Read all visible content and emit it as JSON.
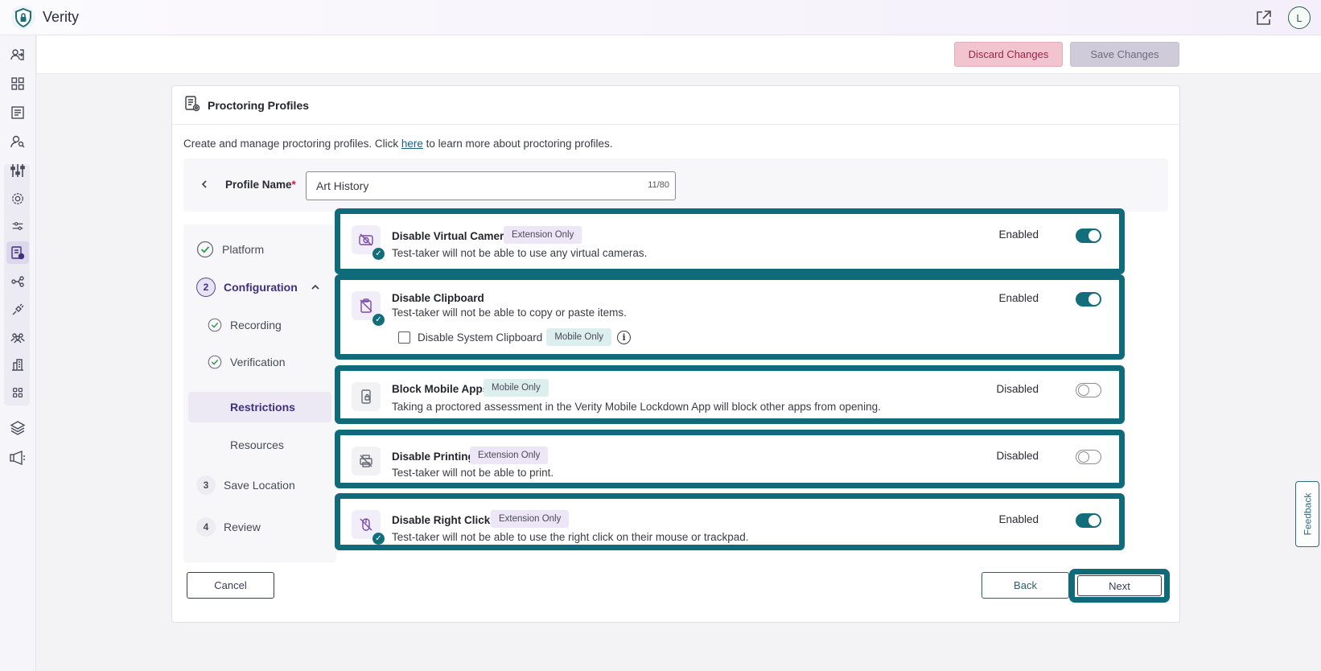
{
  "app": {
    "name": "Verity",
    "avatar_initial": "L"
  },
  "actions": {
    "discard_label": "Discard Changes",
    "save_label": "Save Changes"
  },
  "card": {
    "title": "Proctoring Profiles",
    "intro_before": "Create and manage proctoring profiles. Click ",
    "intro_link": "here",
    "intro_after": " to learn more about proctoring profiles."
  },
  "profile": {
    "label": "Profile Name",
    "required_mark": "*",
    "value": "Art History",
    "char_count": "11/80"
  },
  "steps": {
    "platform": "Platform",
    "configuration_num": "2",
    "configuration": "Configuration",
    "recording": "Recording",
    "verification": "Verification",
    "restrictions": "Restrictions",
    "resources": "Resources",
    "save_location_num": "3",
    "save_location": "Save Location",
    "review_num": "4",
    "review": "Review"
  },
  "restrictions": [
    {
      "title": "Disable Virtual Camera",
      "badge": "Extension Only",
      "desc": "Test-taker will not be able to use any virtual cameras.",
      "state": "Enabled",
      "enabled": true,
      "icon": "camera-off-icon"
    },
    {
      "title": "Disable Clipboard",
      "badge": "",
      "desc": "Test-taker will not be able to copy or paste items.",
      "state": "Enabled",
      "enabled": true,
      "icon": "clipboard-off-icon",
      "sub_option": {
        "label": "Disable System Clipboard",
        "badge": "Mobile Only",
        "checked": false
      }
    },
    {
      "title": "Block Mobile Apps",
      "badge": "Mobile Only",
      "desc": "Taking a proctored assessment in the Verity Mobile Lockdown App will block other apps from opening.",
      "state": "Disabled",
      "enabled": false,
      "icon": "mobile-lock-icon"
    },
    {
      "title": "Disable Printing",
      "badge": "Extension Only",
      "desc": "Test-taker will not be able to print.",
      "state": "Disabled",
      "enabled": false,
      "icon": "printer-off-icon"
    },
    {
      "title": "Disable Right Click",
      "badge": "Extension Only",
      "desc": "Test-taker will not be able to use the right click on their mouse or trackpad.",
      "state": "Enabled",
      "enabled": true,
      "icon": "mouse-off-icon"
    }
  ],
  "footer": {
    "cancel": "Cancel",
    "back": "Back",
    "next": "Next"
  },
  "feedback": "Feedback",
  "colors": {
    "accent": "#0f6a7a",
    "toggle_on": "#136e7c",
    "discard_bg": "#f1c4cf",
    "save_bg": "#cfcbd9",
    "primary_text": "#3a3a60"
  }
}
